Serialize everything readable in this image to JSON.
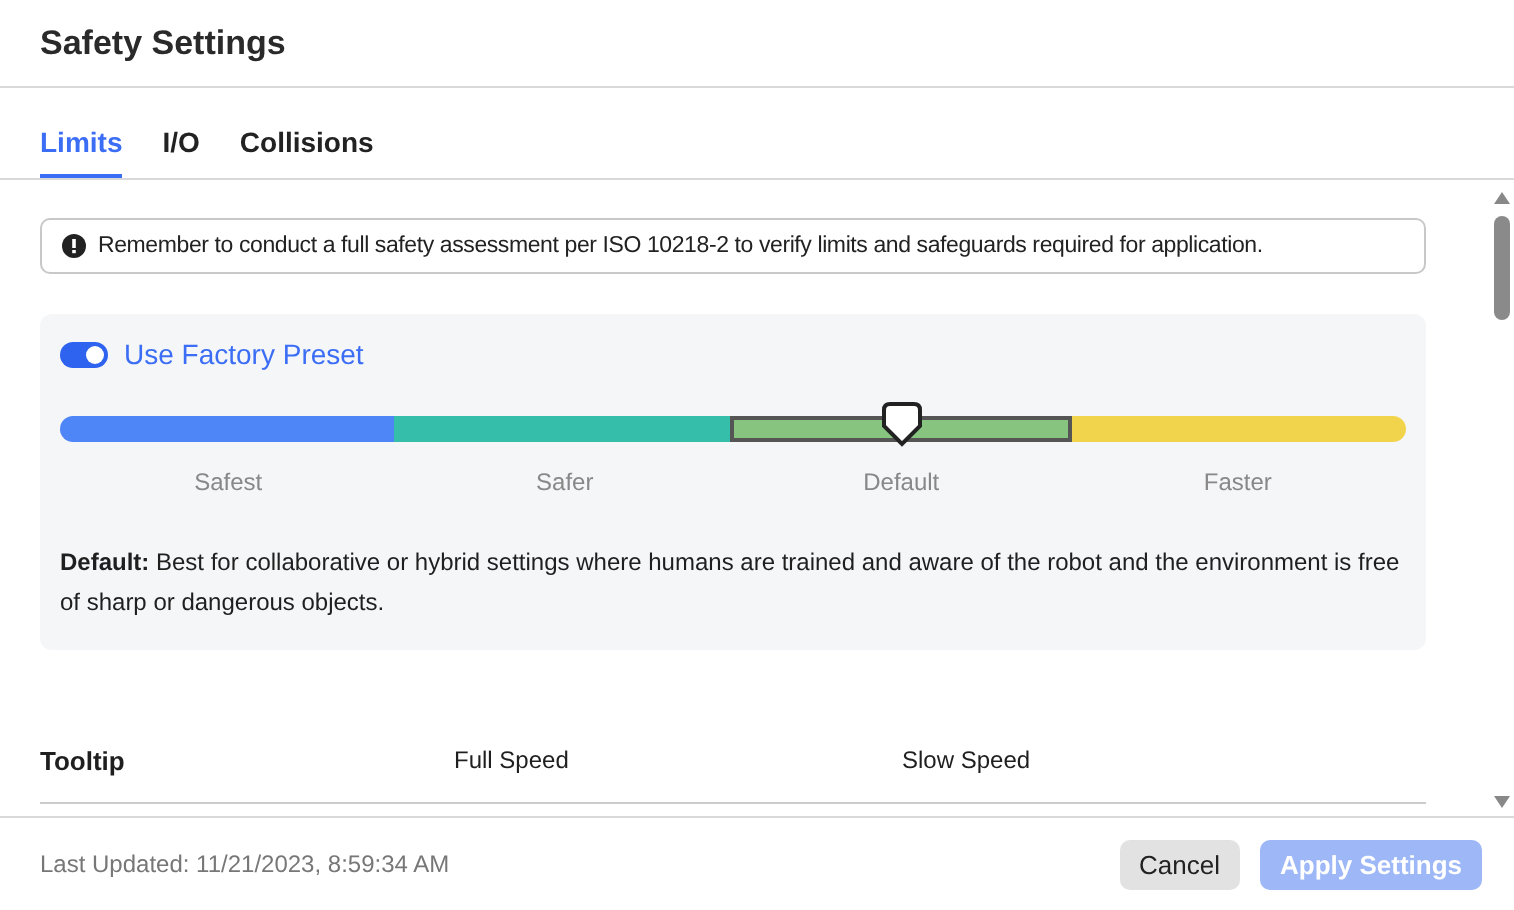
{
  "window": {
    "title": "Safety Settings"
  },
  "tabs": [
    {
      "label": "Limits",
      "selected": true
    },
    {
      "label": "I/O",
      "selected": false
    },
    {
      "label": "Collisions",
      "selected": false
    }
  ],
  "notice": "Remember to conduct a full safety assessment per ISO 10218-2 to verify limits and safeguards required for application.",
  "preset": {
    "label": "Use Factory Preset",
    "on": true,
    "segments": [
      {
        "label": "Safest",
        "color": "#4f86f7",
        "selected": false
      },
      {
        "label": "Safer",
        "color": "#35bfaa",
        "selected": false
      },
      {
        "label": "Default",
        "color": "#86c47f",
        "selected": true
      },
      {
        "label": "Faster",
        "color": "#f2d44c",
        "selected": false
      }
    ],
    "description": "**Default:** Best for collaborative or hybrid settings where humans are trained and aware of the robot and the environment is free of sharp or dangerous objects."
  },
  "table_header": [
    "Tooltip",
    "Full Speed",
    "Slow Speed"
  ],
  "footer": {
    "last_updated": "Last Updated: 11/21/2023, 8:59:34 AM",
    "buttons": [
      {
        "label": "Cancel",
        "kind": "secondary",
        "disabled": false
      },
      {
        "label": "Apply Settings",
        "kind": "primary",
        "disabled": true
      }
    ]
  }
}
